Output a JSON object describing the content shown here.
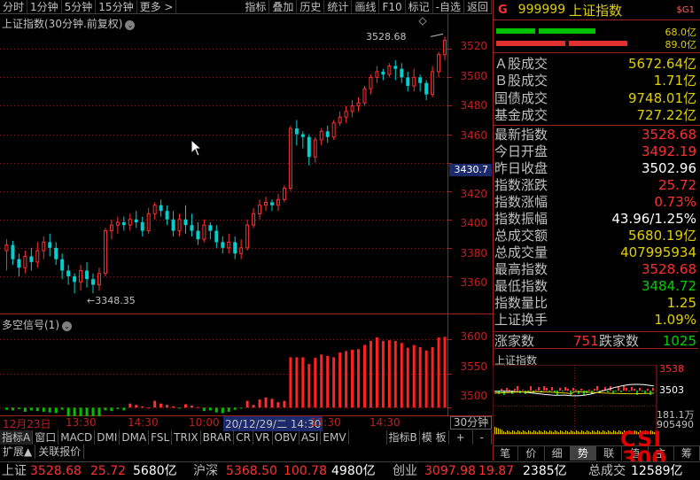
{
  "toolbar": {
    "left": [
      "分时",
      "1分钟",
      "5分钟",
      "15分钟",
      "更多 >"
    ],
    "right": [
      "指标",
      "叠加",
      "历史",
      "统计",
      "画线",
      "F10",
      "标记",
      "-自选",
      "返回"
    ]
  },
  "price_chart": {
    "title": "上证指数(30分钟.前复权)",
    "max_label": "3528.68",
    "min_label": "←3348.35",
    "y_ticks": [
      "3520",
      "3500",
      "3480",
      "3460",
      "3440",
      "3420",
      "3400",
      "3380",
      "3360"
    ],
    "current_price": "3430.7"
  },
  "indicator": {
    "title": "多空信号(1)",
    "y_ticks": [
      "3600",
      "3550",
      "3500"
    ]
  },
  "date_axis": {
    "labels": [
      "12月23日",
      "13:30",
      "14:30",
      "10:00",
      "20/12/29/二 14:30",
      "13:30",
      "14:30"
    ],
    "period": "30分钟"
  },
  "indicator_tabs": [
    "指标A",
    "窗口",
    "MACD",
    "DMI",
    "DMA",
    "FSL",
    "TRIX",
    "BRAR",
    "CR",
    "VR",
    "OBV",
    "ASI",
    "EMV",
    "指标B",
    "模 板",
    "+",
    "-"
  ],
  "ext_tabs": [
    "扩展▲",
    "关联报价"
  ],
  "quote": {
    "flag": "G",
    "code": "999999",
    "name": "上证指数",
    "sg": "$G1",
    "bar1_pct": "68.0亿",
    "bar2_pct": "89.0亿",
    "rows_a": [
      {
        "label": "Ａ股成交",
        "value": "5672.64亿"
      },
      {
        "label": "Ｂ股成交",
        "value": "1.71亿"
      },
      {
        "label": "国债成交",
        "value": "9748.01亿"
      },
      {
        "label": "基金成交",
        "value": "727.22亿"
      }
    ],
    "rows_b": [
      {
        "label": "最新指数",
        "value": "3528.68",
        "color": "red"
      },
      {
        "label": "今日开盘",
        "value": "3492.19",
        "color": "red"
      },
      {
        "label": "昨日收盘",
        "value": "3502.96",
        "color": "wht"
      },
      {
        "label": "指数涨跌",
        "value": "25.72",
        "color": "red"
      },
      {
        "label": "指数涨幅",
        "value": "0.73%",
        "color": "red"
      },
      {
        "label": "指数振幅",
        "value": "43.96/1.25%",
        "color": "wht"
      },
      {
        "label": "总成交额",
        "value": "5680.19亿",
        "color": "yel"
      },
      {
        "label": "总成交量",
        "value": "407995934",
        "color": "yel"
      },
      {
        "label": "最高指数",
        "value": "3528.68",
        "color": "red"
      },
      {
        "label": "最低指数",
        "value": "3484.72",
        "color": "grn"
      },
      {
        "label": "指数量比",
        "value": "1.25",
        "color": "yel"
      },
      {
        "label": "上证换手",
        "value": "1.09%",
        "color": "yel"
      }
    ],
    "up_label": "涨家数",
    "up_value": "751",
    "down_label": "跌家数",
    "down_value": "1025",
    "mini_title": "上证指数",
    "mini_y": [
      "3538",
      "3503"
    ],
    "mini_vol": [
      "181.1万",
      "905490"
    ],
    "tabs": [
      "笔",
      "价",
      "细",
      "势",
      "联",
      "值",
      "主",
      "筹"
    ],
    "active_tab": "势"
  },
  "logo": {
    "line1": "CSI",
    "line2": "300"
  },
  "ticker": {
    "items": [
      {
        "text": "上证",
        "color": "gry"
      },
      {
        "text": "3528.68",
        "color": "red"
      },
      {
        "text": "25.72",
        "color": "red"
      },
      {
        "text": "5680亿",
        "color": "wht"
      },
      {
        "text": "沪深",
        "color": "gry"
      },
      {
        "text": "5368.50",
        "color": "red"
      },
      {
        "text": "100.78",
        "color": "red"
      },
      {
        "text": "4980亿",
        "color": "wht"
      },
      {
        "text": "创业",
        "color": "gry"
      },
      {
        "text": "3097.98",
        "color": "red"
      },
      {
        "text": "19.87",
        "color": "red"
      },
      {
        "text": "2385亿",
        "color": "wht"
      },
      {
        "text": "总成交",
        "color": "gry"
      },
      {
        "text": "12589亿",
        "color": "wht"
      }
    ]
  },
  "colors": {
    "up": "#ff3030",
    "down": "#00d0d0",
    "accent": "#e0d000",
    "axis": "#a02020"
  },
  "chart_data": [
    {
      "type": "candlestick",
      "title": "上证指数(30分钟.前复权)",
      "ylim": [
        3345,
        3532
      ],
      "candles": [
        [
          3378,
          3382,
          3364,
          3386
        ],
        [
          3382,
          3372,
          3368,
          3385
        ],
        [
          3372,
          3366,
          3360,
          3376
        ],
        [
          3366,
          3374,
          3362,
          3378
        ],
        [
          3374,
          3370,
          3364,
          3380
        ],
        [
          3370,
          3378,
          3366,
          3384
        ],
        [
          3378,
          3384,
          3372,
          3388
        ],
        [
          3384,
          3380,
          3374,
          3390
        ],
        [
          3380,
          3372,
          3368,
          3384
        ],
        [
          3372,
          3364,
          3358,
          3376
        ],
        [
          3364,
          3360,
          3354,
          3368
        ],
        [
          3360,
          3356,
          3348,
          3362
        ],
        [
          3356,
          3364,
          3350,
          3368
        ],
        [
          3364,
          3358,
          3352,
          3370
        ],
        [
          3358,
          3354,
          3348,
          3362
        ],
        [
          3354,
          3362,
          3350,
          3366
        ],
        [
          3362,
          3392,
          3360,
          3394
        ],
        [
          3392,
          3396,
          3386,
          3400
        ],
        [
          3396,
          3398,
          3390,
          3402
        ],
        [
          3398,
          3396,
          3392,
          3402
        ],
        [
          3396,
          3400,
          3392,
          3404
        ],
        [
          3400,
          3398,
          3394,
          3406
        ],
        [
          3398,
          3392,
          3388,
          3402
        ],
        [
          3392,
          3404,
          3390,
          3408
        ],
        [
          3404,
          3410,
          3400,
          3412
        ],
        [
          3410,
          3406,
          3402,
          3414
        ],
        [
          3406,
          3400,
          3396,
          3410
        ],
        [
          3400,
          3392,
          3388,
          3406
        ],
        [
          3392,
          3400,
          3388,
          3404
        ],
        [
          3400,
          3396,
          3390,
          3410
        ],
        [
          3396,
          3392,
          3388,
          3404
        ],
        [
          3392,
          3386,
          3382,
          3398
        ],
        [
          3386,
          3396,
          3384,
          3400
        ],
        [
          3396,
          3392,
          3386,
          3398
        ],
        [
          3392,
          3384,
          3380,
          3396
        ],
        [
          3384,
          3380,
          3376,
          3388
        ],
        [
          3380,
          3384,
          3376,
          3390
        ],
        [
          3384,
          3376,
          3372,
          3388
        ],
        [
          3376,
          3380,
          3372,
          3386
        ],
        [
          3380,
          3396,
          3378,
          3400
        ],
        [
          3396,
          3404,
          3394,
          3408
        ],
        [
          3404,
          3410,
          3400,
          3414
        ],
        [
          3410,
          3412,
          3406,
          3416
        ],
        [
          3412,
          3410,
          3406,
          3414
        ],
        [
          3410,
          3414,
          3406,
          3418
        ],
        [
          3414,
          3422,
          3412,
          3424
        ],
        [
          3422,
          3464,
          3420,
          3466
        ],
        [
          3464,
          3460,
          3452,
          3470
        ],
        [
          3460,
          3458,
          3450,
          3462
        ],
        [
          3458,
          3444,
          3438,
          3460
        ],
        [
          3444,
          3456,
          3440,
          3458
        ],
        [
          3456,
          3462,
          3452,
          3464
        ],
        [
          3462,
          3458,
          3454,
          3466
        ],
        [
          3458,
          3468,
          3456,
          3470
        ],
        [
          3468,
          3472,
          3466,
          3476
        ],
        [
          3472,
          3476,
          3468,
          3480
        ],
        [
          3476,
          3480,
          3472,
          3484
        ],
        [
          3480,
          3482,
          3476,
          3486
        ],
        [
          3482,
          3492,
          3480,
          3494
        ],
        [
          3492,
          3500,
          3488,
          3502
        ],
        [
          3500,
          3504,
          3496,
          3508
        ],
        [
          3504,
          3502,
          3498,
          3506
        ],
        [
          3502,
          3508,
          3500,
          3510
        ],
        [
          3508,
          3506,
          3498,
          3512
        ],
        [
          3506,
          3500,
          3496,
          3510
        ],
        [
          3500,
          3494,
          3490,
          3504
        ],
        [
          3494,
          3500,
          3490,
          3506
        ],
        [
          3500,
          3496,
          3490,
          3502
        ],
        [
          3496,
          3488,
          3484,
          3498
        ],
        [
          3488,
          3504,
          3486,
          3508
        ],
        [
          3504,
          3516,
          3500,
          3518
        ],
        [
          3516,
          3526,
          3512,
          3528.68
        ]
      ]
    },
    {
      "type": "bar",
      "title": "多空信号(1)",
      "ylim": [
        3490,
        3620
      ],
      "values": [
        3497,
        3496,
        3498,
        3494,
        3496,
        3495,
        3494,
        3493,
        3492,
        3497,
        3485,
        3482,
        3480,
        3479,
        3478,
        3477,
        3496,
        3495,
        3498,
        3496,
        3506,
        3504,
        3502,
        3500,
        3510,
        3506,
        3504,
        3502,
        3499,
        3505,
        3503,
        3501,
        3495,
        3496,
        3493,
        3492,
        3494,
        3497,
        3499,
        3510,
        3504,
        3512,
        3515,
        3513,
        3508,
        3510,
        3574,
        3574,
        3574,
        3564,
        3573,
        3578,
        3576,
        3574,
        3581,
        3583,
        3585,
        3586,
        3592,
        3598,
        3603,
        3598,
        3599,
        3598,
        3595,
        3588,
        3592,
        3589,
        3584,
        3589,
        3603,
        3604
      ]
    }
  ]
}
